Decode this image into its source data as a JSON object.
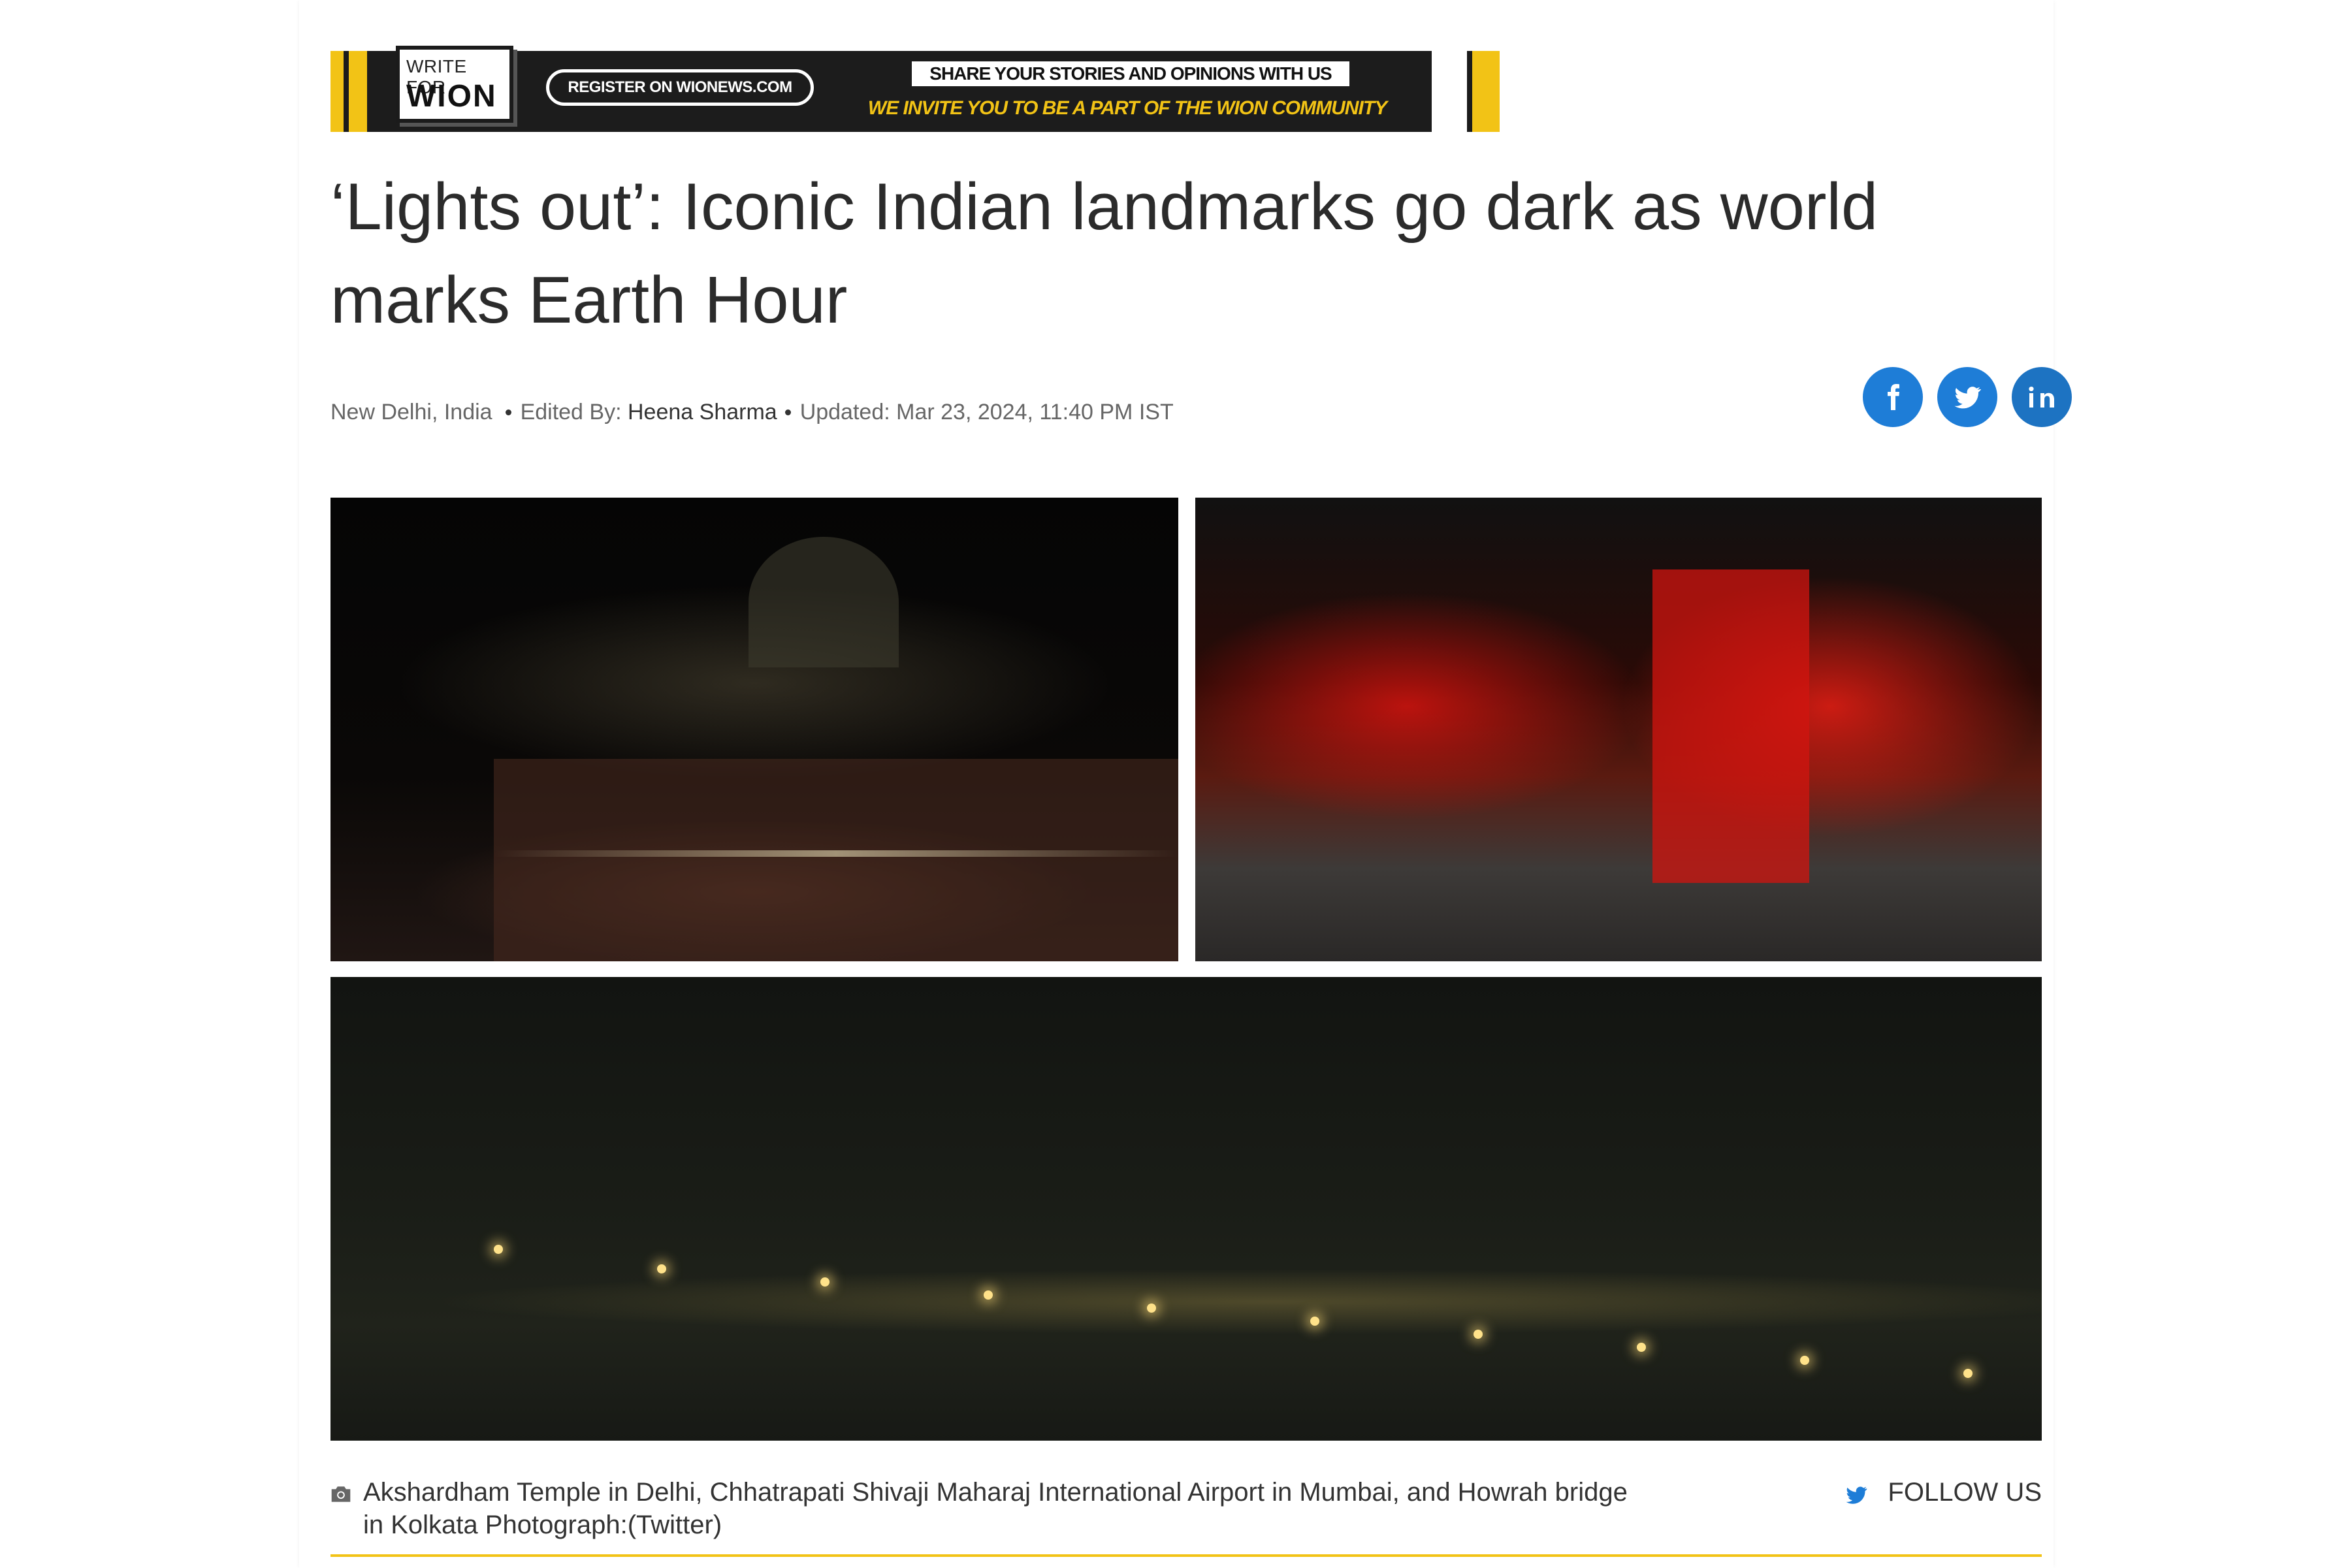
{
  "banner": {
    "logo_top": "WRITE FOR",
    "logo_main": "WION",
    "register": "REGISTER ON WIONEWS.COM",
    "share": "SHARE YOUR STORIES AND OPINIONS WITH US",
    "invite": "WE INVITE YOU TO BE A PART OF THE WION COMMUNITY"
  },
  "article": {
    "title": "‘Lights out’: Iconic Indian landmarks go dark as world marks Earth Hour",
    "location": "New Delhi, India",
    "edited_label": "Edited By:",
    "editor": "Heena Sharma",
    "updated": "Updated: Mar 23, 2024, 11:40 PM IST"
  },
  "social": {
    "icons": [
      "facebook-icon",
      "twitter-icon",
      "linkedin-icon"
    ],
    "color": "#1e7dd7"
  },
  "images": [
    "akshardham-temple-photo",
    "mumbai-station-photo",
    "howrah-bridge-photo"
  ],
  "caption": {
    "text": "Akshardham Temple in Delhi, Chhatrapati Shivaji Maharaj International Airport in Mumbai, and Howrah bridge in Kolkata Photograph:(Twitter)",
    "follow": "FOLLOW US"
  },
  "colors": {
    "accent": "#f2c316",
    "text": "#2b2b2b"
  }
}
